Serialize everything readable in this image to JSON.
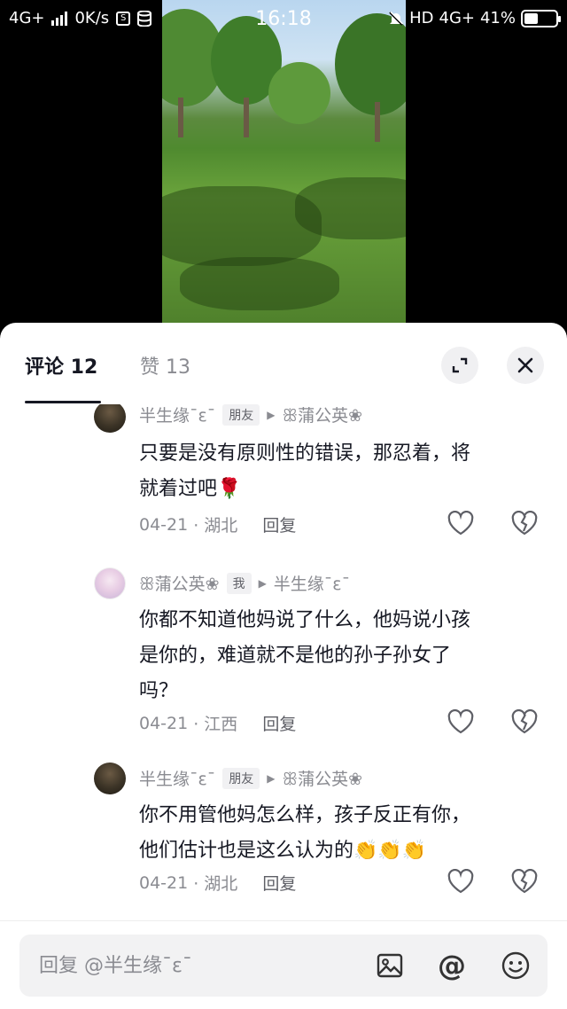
{
  "status_bar": {
    "network": "4G+",
    "speed": "0K/s",
    "time": "16:18",
    "hd": "HD",
    "network_right": "4G+",
    "battery_percent": "41%",
    "battery_level": 0.41
  },
  "video": {
    "description_icon": "park-lawn-video"
  },
  "sheet": {
    "tabs": [
      {
        "label": "评论 12"
      },
      {
        "label": "赞 13"
      }
    ],
    "expand_icon": "expand-icon",
    "close_icon": "close-icon"
  },
  "comments": [
    {
      "author": "半生缘¯ε¯",
      "tag": "朋友",
      "reply_to": "ꕥ蒲公英❀",
      "text_line1": "只要是没有原则性的错误，那忍着，将",
      "text_line2": "就着过吧🌹",
      "date": "04-21",
      "location": "· 湖北",
      "reply": "回复"
    },
    {
      "author": "ꕥ蒲公英❀",
      "tag": "我",
      "reply_to": "半生缘¯ε¯",
      "text_line1": "你都不知道他妈说了什么，他妈说小孩",
      "text_line2": "是你的，难道就不是他的孙子孙女了",
      "text_line3": "吗？",
      "date": "04-21",
      "location": "· 江西",
      "reply": "回复"
    },
    {
      "author": "半生缘¯ε¯",
      "tag": "朋友",
      "reply_to": "ꕥ蒲公英❀",
      "text_line1": "你不用管他妈怎么样，孩子反正有你，",
      "text_line2": "他们估计也是这么认为的👏👏👏",
      "date": "04-21",
      "location": "· 湖北",
      "reply": "回复"
    }
  ],
  "input": {
    "placeholder": "回复 @半生缘¯ε¯",
    "at_symbol": "@"
  },
  "colors": {
    "text_primary": "#161823",
    "text_secondary": "#8a8b91",
    "sheet_bg": "#ffffff"
  }
}
